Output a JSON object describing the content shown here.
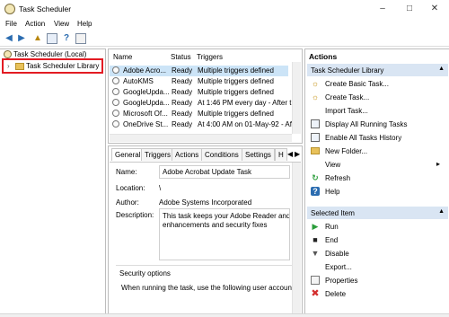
{
  "window": {
    "title": "Task Scheduler"
  },
  "menu": [
    "File",
    "Action",
    "View",
    "Help"
  ],
  "tree": {
    "root": "Task Scheduler (Local)",
    "library": "Task Scheduler Library"
  },
  "tasklist": {
    "headers": [
      "Name",
      "Status",
      "Triggers"
    ],
    "rows": [
      {
        "name": "Adobe Acro...",
        "status": "Ready",
        "triggers": "Multiple triggers defined"
      },
      {
        "name": "AutoKMS",
        "status": "Ready",
        "triggers": "Multiple triggers defined"
      },
      {
        "name": "GoogleUpda...",
        "status": "Ready",
        "triggers": "Multiple triggers defined"
      },
      {
        "name": "GoogleUpda...",
        "status": "Ready",
        "triggers": "At 1:46 PM every day - After tri"
      },
      {
        "name": "Microsoft Of...",
        "status": "Ready",
        "triggers": "Multiple triggers defined"
      },
      {
        "name": "OneDrive St...",
        "status": "Ready",
        "triggers": "At 4:00 AM on 01-May-92 - Afte"
      }
    ]
  },
  "tabs": [
    "General",
    "Triggers",
    "Actions",
    "Conditions",
    "Settings",
    "H"
  ],
  "details": {
    "name_label": "Name:",
    "name_value": "Adobe Acrobat Update Task",
    "location_label": "Location:",
    "location_value": "\\",
    "author_label": "Author:",
    "author_value": "Adobe Systems Incorporated",
    "description_label": "Description:",
    "description_line1": "This task keeps your Adobe Reader and Ac",
    "description_line2": "enhancements and security fixes",
    "security_title": "Security options",
    "security_text": "When running the task, use the following user account:"
  },
  "actions": {
    "header": "Actions",
    "library_header": "Task Scheduler Library",
    "library_items": [
      {
        "label": "Create Basic Task...",
        "icon": "create-basic-task-icon"
      },
      {
        "label": "Create Task...",
        "icon": "create-task-icon"
      },
      {
        "label": "Import Task...",
        "icon": "import-icon"
      },
      {
        "label": "Display All Running Tasks",
        "icon": "running-tasks-icon"
      },
      {
        "label": "Enable All Tasks History",
        "icon": "history-icon"
      },
      {
        "label": "New Folder...",
        "icon": "folder-icon"
      },
      {
        "label": "View",
        "icon": "view-icon"
      },
      {
        "label": "Refresh",
        "icon": "refresh-icon"
      },
      {
        "label": "Help",
        "icon": "help-icon"
      }
    ],
    "selected_header": "Selected Item",
    "selected_items": [
      {
        "label": "Run",
        "icon": "run-icon"
      },
      {
        "label": "End",
        "icon": "end-icon"
      },
      {
        "label": "Disable",
        "icon": "disable-icon"
      },
      {
        "label": "Export...",
        "icon": "export-icon"
      },
      {
        "label": "Properties",
        "icon": "properties-icon"
      },
      {
        "label": "Delete",
        "icon": "delete-icon"
      }
    ]
  }
}
